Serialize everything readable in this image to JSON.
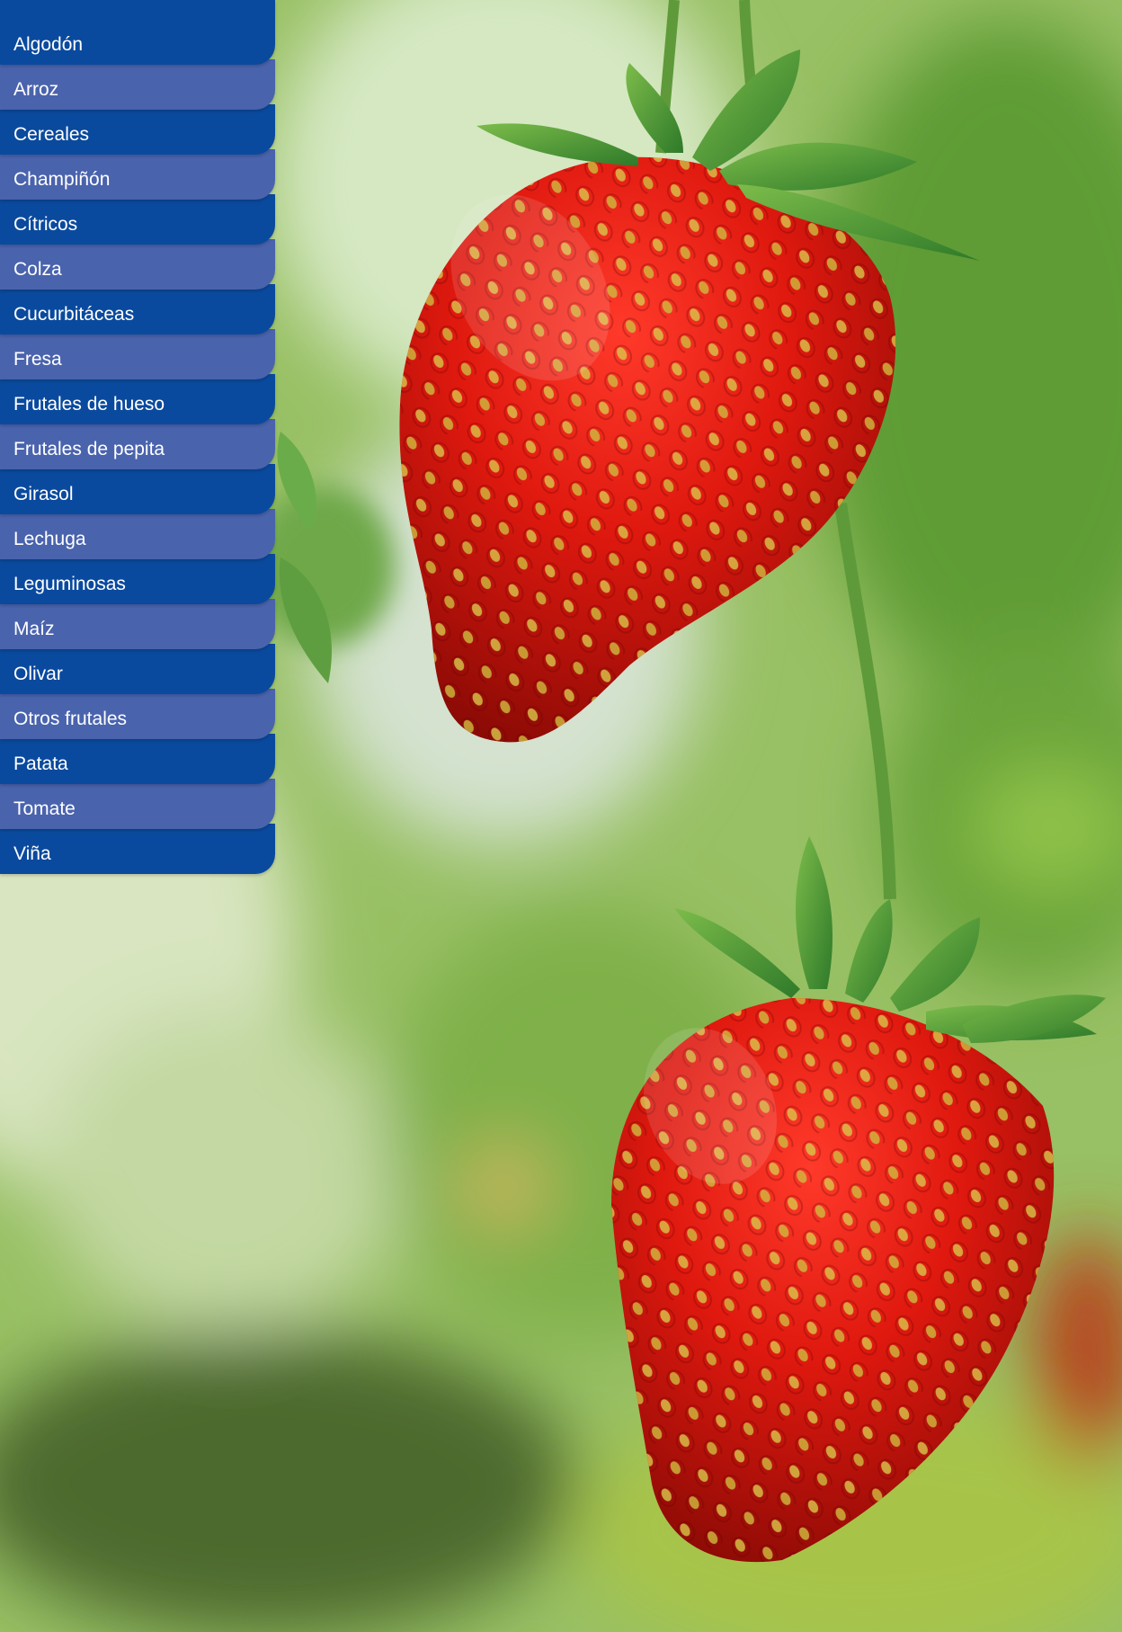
{
  "menu": {
    "items": [
      {
        "label": "Algodón"
      },
      {
        "label": "Arroz"
      },
      {
        "label": "Cereales"
      },
      {
        "label": "Champiñón"
      },
      {
        "label": "Cítricos"
      },
      {
        "label": "Colza"
      },
      {
        "label": "Cucurbitáceas"
      },
      {
        "label": "Fresa"
      },
      {
        "label": "Frutales de hueso"
      },
      {
        "label": "Frutales de pepita"
      },
      {
        "label": "Girasol"
      },
      {
        "label": "Lechuga"
      },
      {
        "label": "Leguminosas"
      },
      {
        "label": "Maíz"
      },
      {
        "label": "Olivar"
      },
      {
        "label": "Otros frutales"
      },
      {
        "label": "Patata"
      },
      {
        "label": "Tomate"
      },
      {
        "label": "Viña"
      }
    ],
    "colors": {
      "dark": "#0a4a9e",
      "light": "#4a63ad",
      "text": "#ffffff"
    }
  },
  "hero": {
    "image": "strawberries-photo"
  }
}
